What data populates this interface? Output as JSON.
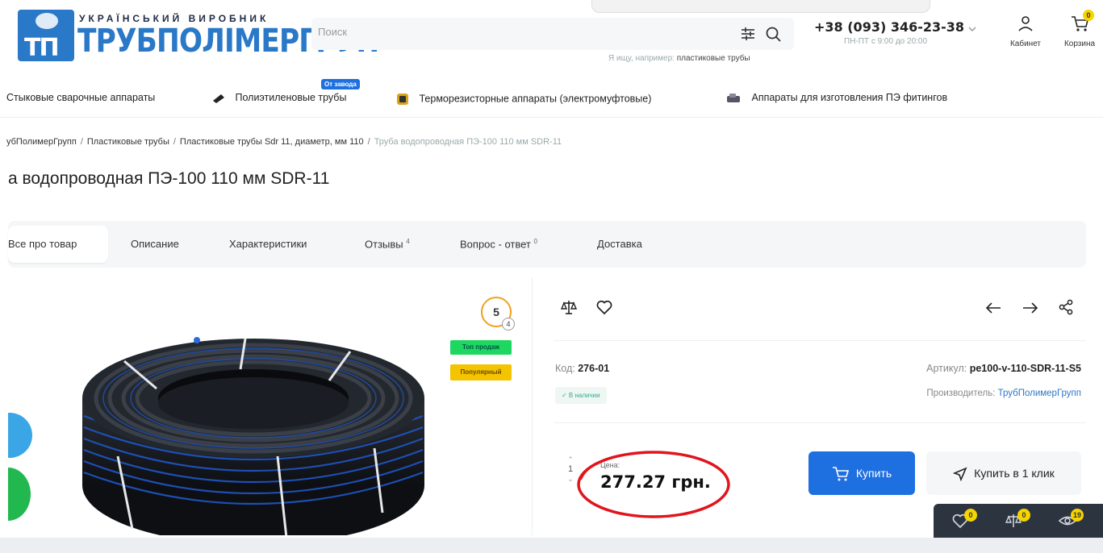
{
  "header": {
    "logo_sub": "УКРАЇНСЬКИЙ ВИРОБНИК",
    "logo_main": "ТРУБПОЛІМЕРГРУП",
    "search_placeholder": "Поиск",
    "search_hint_prefix": "Я ищу, например:",
    "search_hint_example": "пластиковые трубы",
    "phone": "+38 (093) 346-23-38",
    "hours": "ПН-ПТ с 9:00 до 20:00",
    "cabinet_label": "Кабинет",
    "cart_label": "Корзина",
    "cart_count": "0"
  },
  "categories": [
    {
      "label": "Стыковые сварочные аппараты",
      "icon": "welding-icon"
    },
    {
      "label": "Полиэтиленовые трубы",
      "icon": "pipe-icon",
      "badge": "От завода"
    },
    {
      "label": "Терморезисторные аппараты (электромуфтовые)",
      "icon": "machine-icon"
    },
    {
      "label": "Аппараты для изготовления ПЭ фитингов",
      "icon": "fitting-machine-icon"
    }
  ],
  "breadcrumbs": [
    "ТрубПолимерГрупп",
    "Пластиковые трубы",
    "Пластиковые трубы Sdr 11, диаметр, мм 110",
    "Труба водопроводная ПЭ-100 110 мм SDR-11"
  ],
  "breadcrumb_visible_first": "убПолимерГрупп",
  "product": {
    "title_visible": "а водопроводная ПЭ-100 110 мм SDR-11",
    "rating": "5",
    "rating_count": "4",
    "tag_top": "Топ продаж",
    "tag_popular": "Популярный",
    "code_label": "Код:",
    "code": "276-01",
    "in_stock": "✓ В наличии",
    "sku_label": "Артикул:",
    "sku": "pe100-v-110-SDR-11-S5",
    "maker_label": "Производитель:",
    "maker": "ТрубПолимерГрупп",
    "qty": "1",
    "price_label": "Цена:",
    "price": "277.27 грн.",
    "buy_label": "Купить",
    "oneclick_label": "Купить в 1 клик"
  },
  "tabs": [
    {
      "label": "Все про товар"
    },
    {
      "label": "Описание"
    },
    {
      "label": "Характеристики"
    },
    {
      "label": "Отзывы",
      "count": "4"
    },
    {
      "label": "Вопрос - ответ",
      "count": "0"
    },
    {
      "label": "Доставка"
    }
  ],
  "floatbar": {
    "favorites_count": "0",
    "compare_count": "0",
    "viewed_count": "19"
  },
  "colors": {
    "brand_blue": "#2a78c8",
    "button_blue": "#1e6fe0",
    "annotation_red": "#e0151d",
    "badge_yellow": "#f5d400",
    "tag_green": "#1ed760"
  }
}
